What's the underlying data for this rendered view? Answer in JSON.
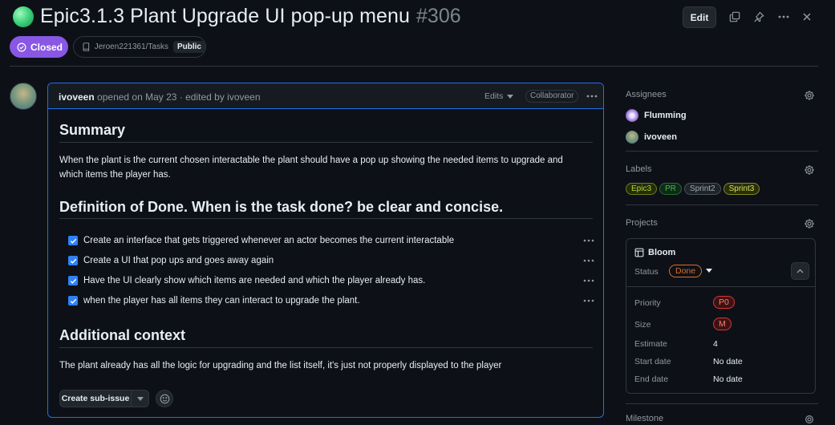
{
  "header": {
    "title": "Epic3.1.3 Plant Upgrade UI pop-up menu",
    "number": "#306",
    "edit_label": "Edit",
    "state_label": "Closed",
    "repo": "Jeroen221361/Tasks",
    "visibility": "Public",
    "icons": [
      "copy-icon",
      "pin-icon",
      "more-icon",
      "close-icon"
    ]
  },
  "comment": {
    "author": "ivoveen",
    "meta": "opened on May 23 · edited by ivoveen",
    "edits_label": "Edits",
    "role": "Collaborator",
    "summary_heading": "Summary",
    "summary_text": "When the plant is the current chosen interactable the plant should have a pop up showing the needed items to upgrade and which items the player has.",
    "dod_heading": "Definition of Done. When is the task done? be clear and concise.",
    "tasks": [
      {
        "text": "Create an interface that gets triggered whenever an actor becomes the current interactable",
        "checked": true
      },
      {
        "text": "Create a UI that pop ups and goes away again",
        "checked": true
      },
      {
        "text": "Have the UI clearly show which items are needed and which the player already has.",
        "checked": true
      },
      {
        "text": "when the player has all items they can interact to upgrade the plant.",
        "checked": true
      }
    ],
    "context_heading": "Additional context",
    "context_text": "The plant already has all the logic for upgrading and the list itself, it's just not properly displayed to the player",
    "sub_issue_label": "Create sub-issue"
  },
  "sidebar": {
    "assignees_heading": "Assignees",
    "assignees": [
      {
        "name": "Flumming"
      },
      {
        "name": "ivoveen"
      }
    ],
    "labels_heading": "Labels",
    "labels": [
      {
        "name": "Epic3",
        "color": "#b4d330"
      },
      {
        "name": "PR",
        "color": "#3fb950"
      },
      {
        "name": "Sprint2",
        "color": "#8b949e"
      },
      {
        "name": "Sprint3",
        "color": "#d4e157"
      }
    ],
    "projects_heading": "Projects",
    "project": {
      "name": "Bloom",
      "status_label": "Status",
      "status": "Done",
      "fields": {
        "priority_label": "Priority",
        "priority": "P0",
        "size_label": "Size",
        "size": "M",
        "estimate_label": "Estimate",
        "estimate": "4",
        "start_label": "Start date",
        "start": "No date",
        "end_label": "End date",
        "end": "No date"
      }
    },
    "milestone_heading": "Milestone"
  },
  "colors": {
    "background": "#0d1117",
    "accent": "#1f6feb",
    "closed": "#8957e5",
    "done": "#db6d28"
  }
}
